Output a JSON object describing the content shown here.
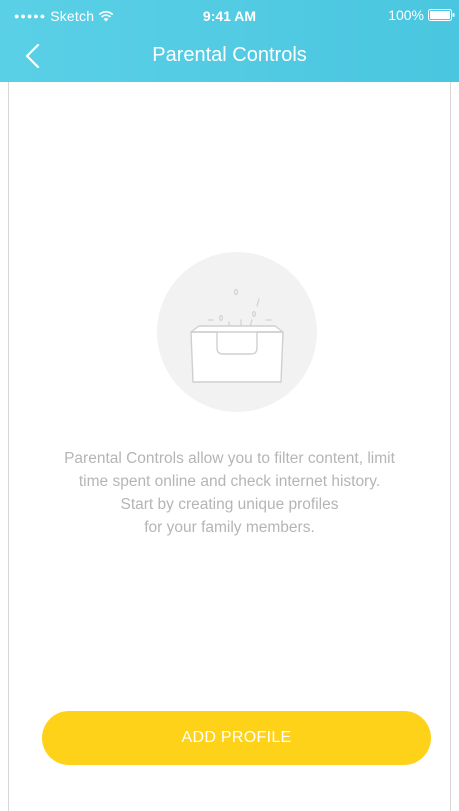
{
  "status_bar": {
    "carrier": "Sketch",
    "signal_dots": "●●●●●",
    "time": "9:41 AM",
    "battery_percent": "100%"
  },
  "nav": {
    "title": "Parental Controls",
    "back_icon": "chevron-left-icon"
  },
  "empty_state": {
    "illustration_icon": "empty-tray-icon",
    "message_lines": [
      "Parental Controls allow you to filter content, limit",
      "time spent online and check internet history.",
      "Start by creating unique profiles",
      "for your family members."
    ]
  },
  "actions": {
    "add_profile_label": "ADD PROFILE"
  },
  "colors": {
    "header": "#4ac6e0",
    "button": "#ffd21a",
    "message_text": "#b5b5b5"
  }
}
